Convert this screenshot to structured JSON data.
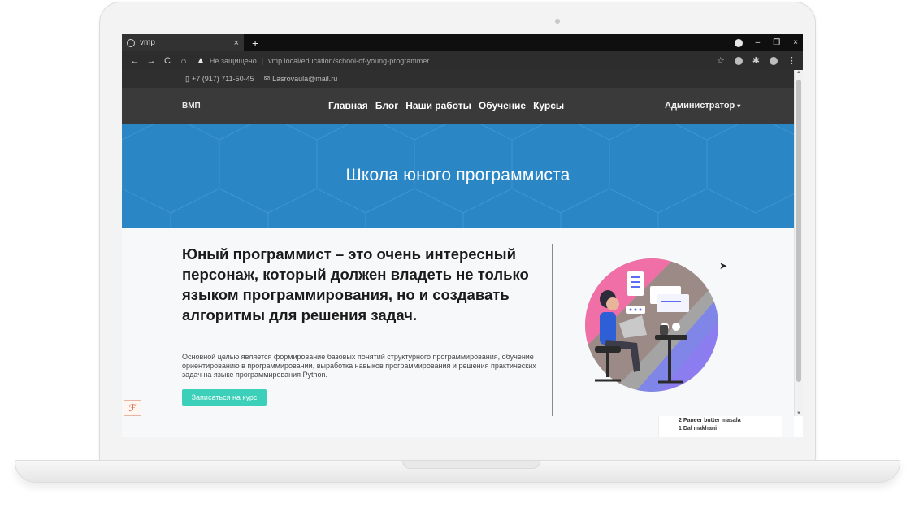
{
  "browser": {
    "tab_title": "vmp",
    "close_glyph": "×",
    "new_tab_glyph": "+",
    "address_warning": "Не защищено",
    "url": "vmp.local/education/school-of-young-programmer",
    "back_glyph": "←",
    "forward_glyph": "→",
    "reload_glyph": "C",
    "home_glyph": "⌂",
    "star_glyph": "☆",
    "menu_glyph": "⋮",
    "minimize_glyph": "–",
    "maximize_glyph": "❐",
    "window_close_glyph": "×"
  },
  "contact": {
    "phone_icon": "phone-icon",
    "phone": "+7 (917) 711-50-45",
    "email_icon": "mail-icon",
    "email": "Lasrovaula@mail.ru"
  },
  "nav": {
    "brand": "ВМП",
    "items": [
      "Главная",
      "Блог",
      "Наши работы",
      "Обучение",
      "Курсы"
    ],
    "admin": "Администратор",
    "caret": "▾"
  },
  "hero": {
    "title": "Школа юного программиста",
    "color": "#2b86c5"
  },
  "main": {
    "headline": "Юный программист – это очень интересный персонаж, который должен владеть не только языком программирования, но и создавать алгоритмы для решения задач.",
    "description": "Основной целью является формирование базовых понятий структурного программирования, обучение ориентированию в программировании, выработка навыков программирования и решения практических задач на языке программирования Python.",
    "cta_label": "Записаться на курс",
    "cta_color": "#3ccfb9"
  },
  "overlay": {
    "lines": [
      "2 Paneer butter masala",
      "1 Dal makhani"
    ]
  }
}
